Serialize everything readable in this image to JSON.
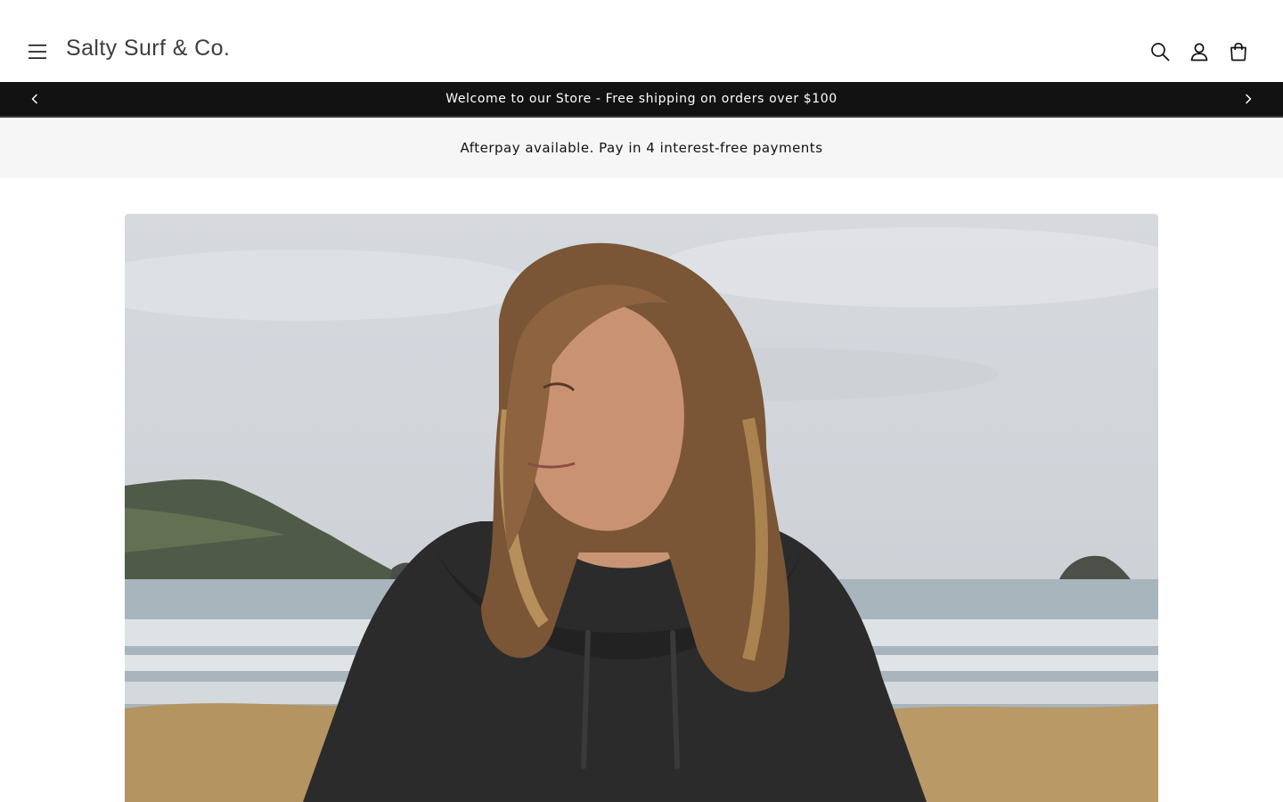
{
  "header": {
    "store_name": "Salty Surf & Co.",
    "icons": {
      "menu": "hamburger-menu-icon",
      "search": "search-icon",
      "account": "account-icon",
      "cart": "cart-icon"
    }
  },
  "announcement": {
    "message": "Welcome to our Store - Free shipping on orders over $100",
    "prev_icon": "chevron-left-icon",
    "next_icon": "chevron-right-icon"
  },
  "promo": {
    "message": "Afterpay available. Pay in 4 interest-free payments"
  },
  "colors": {
    "announcement_bg": "#121212",
    "promo_bg": "#f6f6f6",
    "text": "#121212"
  }
}
